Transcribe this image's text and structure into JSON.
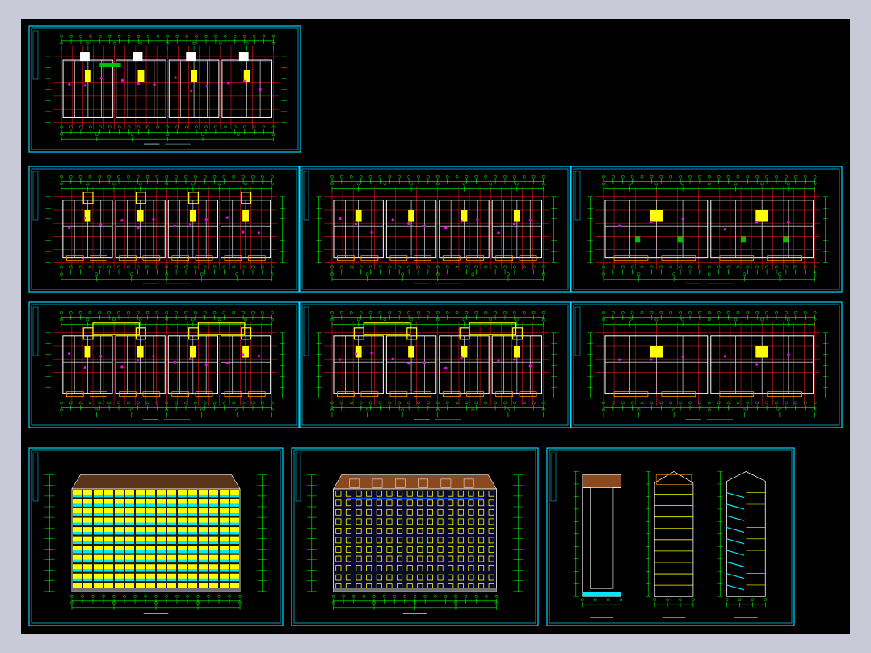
{
  "colors": {
    "background": "#c9cad8",
    "canvas": "#000000",
    "frame": "#00d8ff",
    "dims": "#00ff00",
    "grid_axes": "#ff2020",
    "walls": "#ffffff",
    "fill_yellow": "#ffff00",
    "accent_magenta": "#ff00ff",
    "accent_orange": "#ff9900",
    "roof_brown": "#8a4a1e",
    "glass_cyan": "#00e6ff",
    "blue": "#2040ff"
  },
  "sheets": {
    "roof_plan": {
      "kind": "plan",
      "variant": "roof"
    },
    "row1": [
      {
        "kind": "plan",
        "variant": "a"
      },
      {
        "kind": "plan",
        "variant": "b"
      },
      {
        "kind": "plan",
        "variant": "c"
      }
    ],
    "row2": [
      {
        "kind": "plan",
        "variant": "d"
      },
      {
        "kind": "plan",
        "variant": "d"
      },
      {
        "kind": "plan",
        "variant": "e"
      }
    ],
    "elevations": [
      {
        "kind": "elevation",
        "variant": "front"
      },
      {
        "kind": "elevation",
        "variant": "rear"
      },
      {
        "kind": "section",
        "variant": "sides"
      }
    ]
  }
}
